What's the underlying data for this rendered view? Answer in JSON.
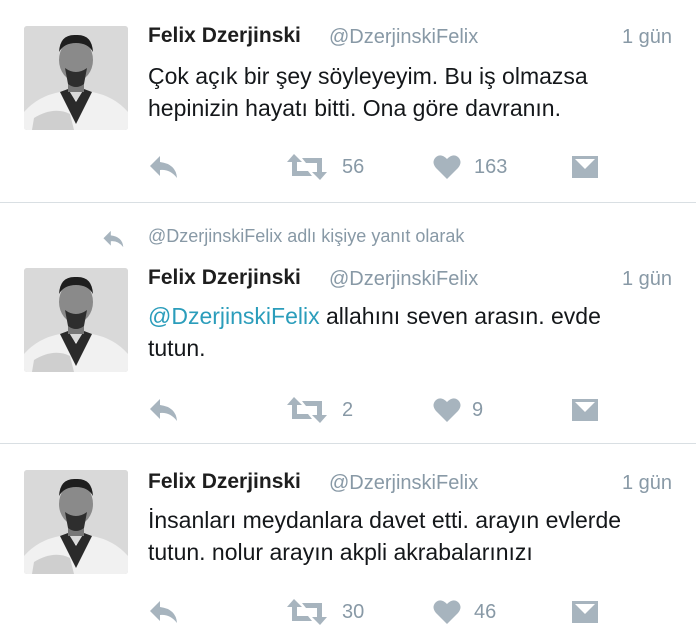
{
  "colors": {
    "icon": "#a7b4be",
    "meta_text": "#8899a6",
    "mention": "#2b9dbb",
    "divider": "#d9dfe3"
  },
  "reply_context": {
    "icon": "reply-icon",
    "text": "@DzerjinskiFelix adlı kişiye yanıt olarak"
  },
  "tweets": [
    {
      "author": "Felix Dzerjinski",
      "handle": "@DzerjinskiFelix",
      "time": "1 gün",
      "text_line1": "Çok açık bir şey söyleyeyim. Bu iş olmazsa",
      "text_line2": "hepinizin hayatı bitti. Ona göre davranın.",
      "retweets": "56",
      "likes": "163"
    },
    {
      "author": "Felix Dzerjinski",
      "handle": "@DzerjinskiFelix",
      "time": "1 gün",
      "mention": "@DzerjinskiFelix",
      "text_line1_rest": " allahını seven arasın. evde",
      "text_line2": "tutun.",
      "retweets": "2",
      "likes": "9"
    },
    {
      "author": "Felix Dzerjinski",
      "handle": "@DzerjinskiFelix",
      "time": "1 gün",
      "text_line1": "İnsanları meydanlara davet etti. arayın evlerde",
      "text_line2": "tutun. nolur arayın akpli akrabalarınızı",
      "retweets": "30",
      "likes": "46"
    }
  ]
}
